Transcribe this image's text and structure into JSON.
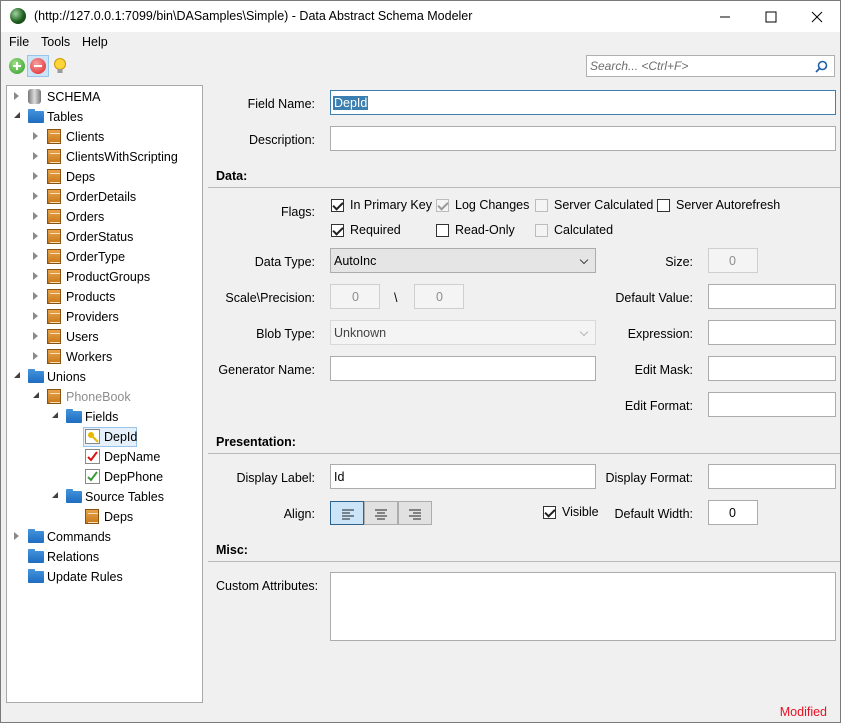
{
  "window": {
    "title": "(http://127.0.0.1:7099/bin\\DASamples\\Simple) - Data Abstract Schema Modeler"
  },
  "menu": [
    "File",
    "Tools",
    "Help"
  ],
  "search": {
    "placeholder": "Search... <Ctrl+F>"
  },
  "tree": [
    {
      "label": "SCHEMA",
      "icon": "database-icon",
      "expander": "collapsed"
    },
    {
      "label": "Tables",
      "icon": "folder-icon",
      "expander": "expanded"
    },
    {
      "label": "Clients",
      "icon": "table-icon",
      "expander": "collapsed"
    },
    {
      "label": "ClientsWithScripting",
      "icon": "table-icon",
      "expander": "collapsed"
    },
    {
      "label": "Deps",
      "icon": "table-icon",
      "expander": "collapsed"
    },
    {
      "label": "OrderDetails",
      "icon": "table-icon",
      "expander": "collapsed"
    },
    {
      "label": "Orders",
      "icon": "table-icon",
      "expander": "collapsed"
    },
    {
      "label": "OrderStatus",
      "icon": "table-icon",
      "expander": "collapsed"
    },
    {
      "label": "OrderType",
      "icon": "table-icon",
      "expander": "collapsed"
    },
    {
      "label": "ProductGroups",
      "icon": "table-icon",
      "expander": "collapsed"
    },
    {
      "label": "Products",
      "icon": "table-icon",
      "expander": "collapsed"
    },
    {
      "label": "Providers",
      "icon": "table-icon",
      "expander": "collapsed"
    },
    {
      "label": "Users",
      "icon": "table-icon",
      "expander": "collapsed"
    },
    {
      "label": "Workers",
      "icon": "table-icon",
      "expander": "collapsed"
    },
    {
      "label": "Unions",
      "icon": "folder-icon",
      "expander": "expanded"
    },
    {
      "label": "PhoneBook",
      "icon": "table-icon",
      "expander": "expanded"
    },
    {
      "label": "Fields",
      "icon": "folder-icon",
      "expander": "expanded"
    },
    {
      "label": "DepId",
      "icon": "key-field-icon",
      "expander": "none"
    },
    {
      "label": "DepName",
      "icon": "required-field-icon",
      "expander": "none"
    },
    {
      "label": "DepPhone",
      "icon": "field-icon",
      "expander": "none"
    },
    {
      "label": "Source Tables",
      "icon": "folder-icon",
      "expander": "expanded"
    },
    {
      "label": "Deps",
      "icon": "table-icon",
      "expander": "none"
    },
    {
      "label": "Commands",
      "icon": "folder-icon",
      "expander": "collapsed"
    },
    {
      "label": "Relations",
      "icon": "folder-icon",
      "expander": "none"
    },
    {
      "label": "Update Rules",
      "icon": "folder-icon",
      "expander": "none"
    }
  ],
  "form": {
    "field_name_label": "Field Name:",
    "field_name_value": "DepId",
    "description_label": "Description:",
    "description_value": "",
    "data_section": "Data:",
    "flags_label": "Flags:",
    "flags": [
      {
        "label": "In Primary Key",
        "checked": true,
        "enabled": true
      },
      {
        "label": "Log Changes",
        "checked": true,
        "enabled": false
      },
      {
        "label": "Server Calculated",
        "checked": false,
        "enabled": false
      },
      {
        "label": "Server Autorefresh",
        "checked": false,
        "enabled": true
      },
      {
        "label": "Required",
        "checked": true,
        "enabled": true
      },
      {
        "label": "Read-Only",
        "checked": false,
        "enabled": true
      },
      {
        "label": "Calculated",
        "checked": false,
        "enabled": false
      }
    ],
    "data_type_label": "Data Type:",
    "data_type_value": "AutoInc",
    "size_label": "Size:",
    "size_value": "0",
    "scale_label": "Scale\\Precision:",
    "scale_value": "0",
    "scale_sep": "\\",
    "precision_value": "0",
    "default_value_label": "Default Value:",
    "default_value": "",
    "blob_type_label": "Blob Type:",
    "blob_type_value": "Unknown",
    "expression_label": "Expression:",
    "expression_value": "",
    "generator_label": "Generator Name:",
    "generator_value": "",
    "edit_mask_label": "Edit Mask:",
    "edit_mask_value": "",
    "edit_format_label": "Edit Format:",
    "edit_format_value": "",
    "presentation_section": "Presentation:",
    "display_label_label": "Display Label:",
    "display_label_value": "Id",
    "display_format_label": "Display Format:",
    "display_format_value": "",
    "align_label": "Align:",
    "align_selected": "left",
    "visible_label": "Visible",
    "visible_checked": true,
    "default_width_label": "Default Width:",
    "default_width_value": "0",
    "misc_section": "Misc:",
    "custom_attributes_label": "Custom Attributes:",
    "custom_attributes_value": ""
  },
  "status": "Modified",
  "colors": {
    "accent": "#3c7fb1",
    "status": "#e81123",
    "folder": "#1e6cc0",
    "table": "#d98a2b"
  }
}
